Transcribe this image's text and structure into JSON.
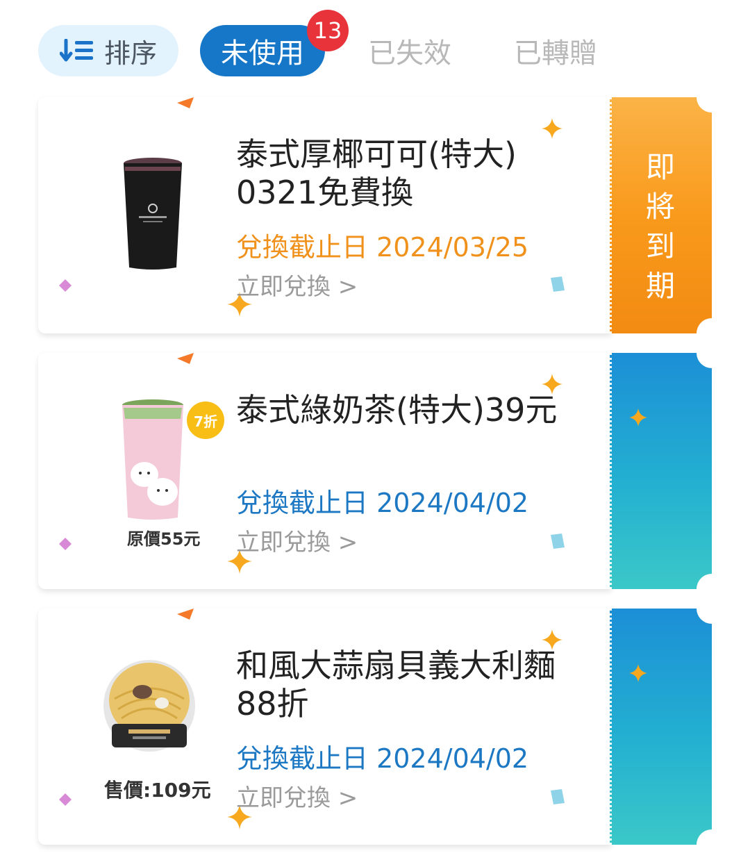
{
  "toolbar": {
    "sort_label": "排序",
    "tabs": [
      {
        "label": "未使用",
        "badge": "13",
        "active": true
      },
      {
        "label": "已失效",
        "active": false
      },
      {
        "label": "已轉贈",
        "active": false
      }
    ]
  },
  "coupons": [
    {
      "title": "泰式厚椰可可(特大) 0321免費換",
      "deadline": "兌換截止日 2024/03/25",
      "redeem": "立即兌換 >",
      "stub_text": "即將到期",
      "stub_color": "#f99a1c",
      "image": "black-coffee-cup-icon"
    },
    {
      "title": "泰式綠奶茶(特大)39元",
      "deadline": "兌換截止日 2024/04/02",
      "redeem": "立即兌換 >",
      "discount_badge": "7折",
      "price_note": "原價55元",
      "stub_color": "#1c8fd6",
      "image": "milk-tea-cup-icon"
    },
    {
      "title": "和風大蒜扇貝義大利麵88折",
      "deadline": "兌換截止日 2024/04/02",
      "redeem": "立即兌換 >",
      "price_note": "售價:109元",
      "stub_color": "#1c8fd6",
      "image": "pasta-bowl-icon"
    }
  ],
  "colors": {
    "accent": "#1677c9",
    "badge": "#e8333b",
    "expiring": "#f0911c",
    "deadline_blue": "#1d78c4"
  }
}
